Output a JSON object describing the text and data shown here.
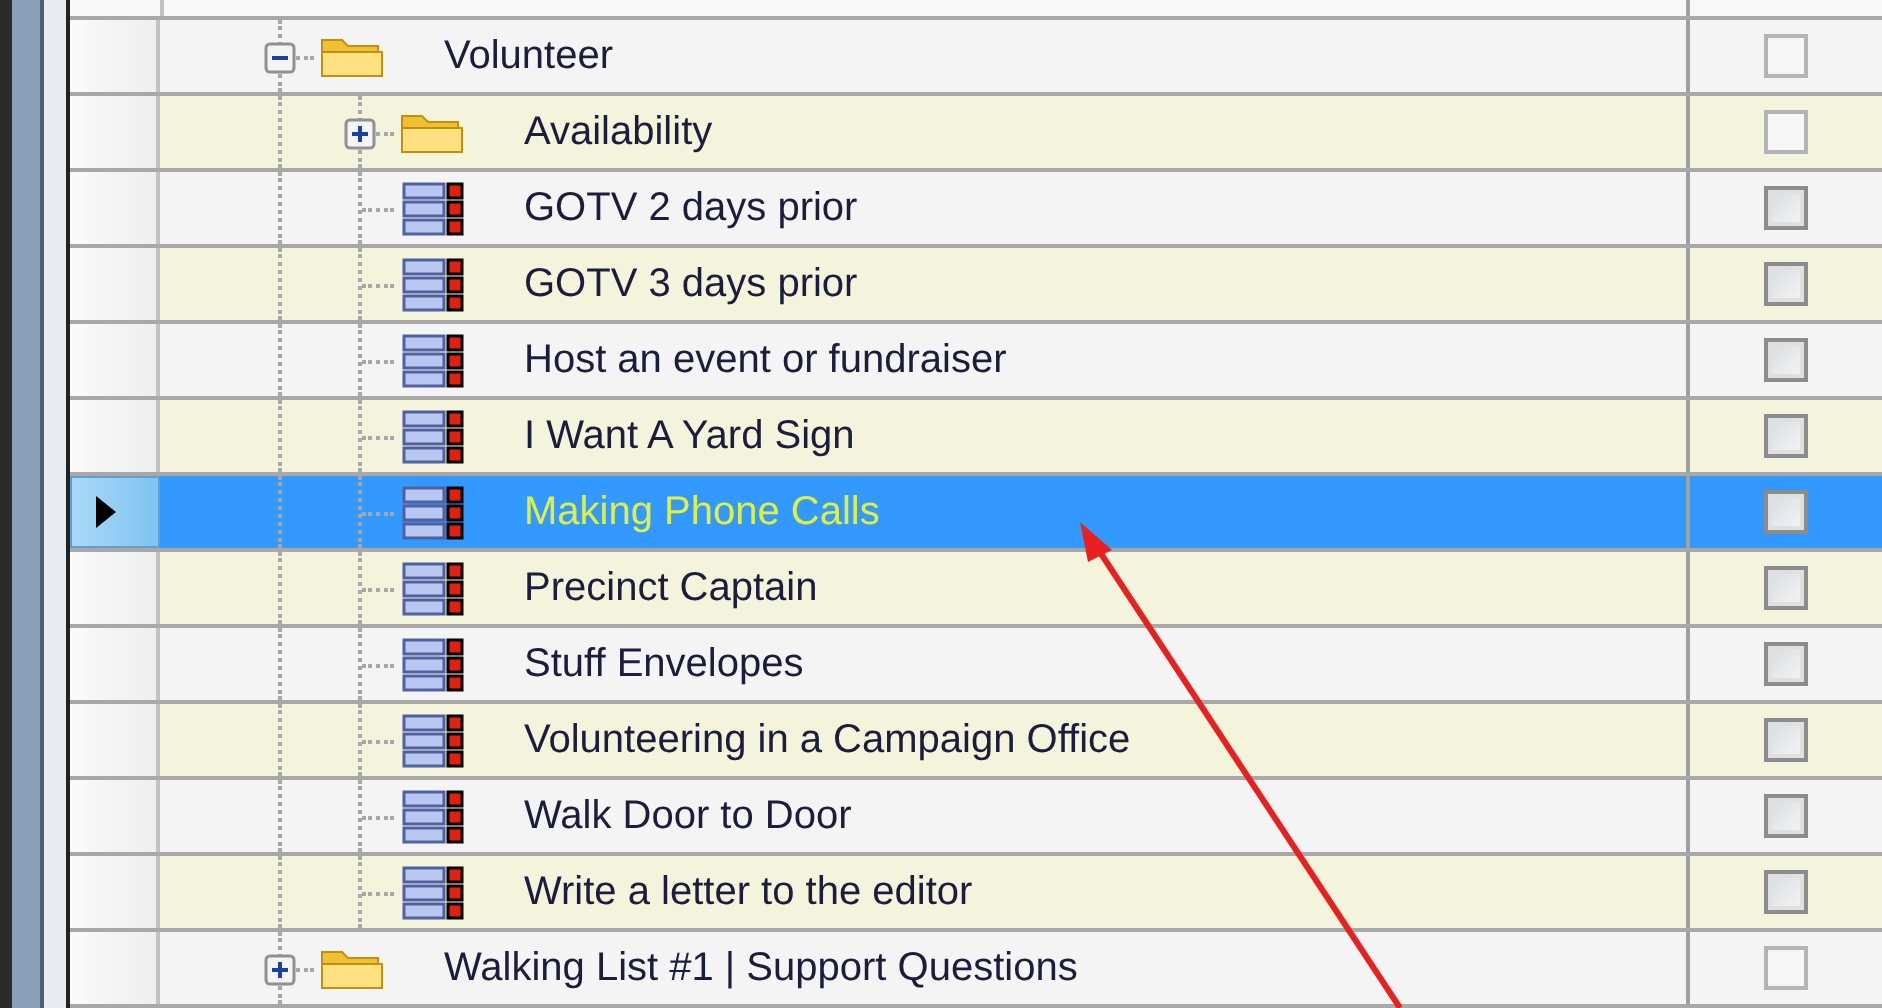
{
  "tree": [
    {
      "kind": "folder",
      "label": "Volunteer",
      "expanded": true,
      "checked": false,
      "disabled": true,
      "selected": false,
      "children": [
        {
          "kind": "folder",
          "label": "Availability",
          "expanded": false,
          "checked": false,
          "disabled": true,
          "selected": false
        },
        {
          "kind": "item",
          "label": "GOTV 2 days prior",
          "checked": false,
          "disabled": false,
          "selected": false
        },
        {
          "kind": "item",
          "label": "GOTV 3 days prior",
          "checked": false,
          "disabled": false,
          "selected": false
        },
        {
          "kind": "item",
          "label": "Host an event or fundraiser",
          "checked": false,
          "disabled": false,
          "selected": false
        },
        {
          "kind": "item",
          "label": "I Want A Yard Sign",
          "checked": false,
          "disabled": false,
          "selected": false
        },
        {
          "kind": "item",
          "label": "Making Phone Calls",
          "checked": false,
          "disabled": false,
          "selected": true
        },
        {
          "kind": "item",
          "label": "Precinct Captain",
          "checked": false,
          "disabled": false,
          "selected": false
        },
        {
          "kind": "item",
          "label": "Stuff Envelopes",
          "checked": false,
          "disabled": false,
          "selected": false
        },
        {
          "kind": "item",
          "label": "Volunteering in a Campaign Office",
          "checked": false,
          "disabled": false,
          "selected": false
        },
        {
          "kind": "item",
          "label": "Walk Door to Door",
          "checked": false,
          "disabled": false,
          "selected": false
        },
        {
          "kind": "item",
          "label": "Write a letter to the editor",
          "checked": false,
          "disabled": false,
          "selected": false
        }
      ]
    },
    {
      "kind": "folder",
      "label": "Walking List #1 | Support Questions",
      "expanded": false,
      "checked": false,
      "disabled": true,
      "selected": false
    }
  ]
}
